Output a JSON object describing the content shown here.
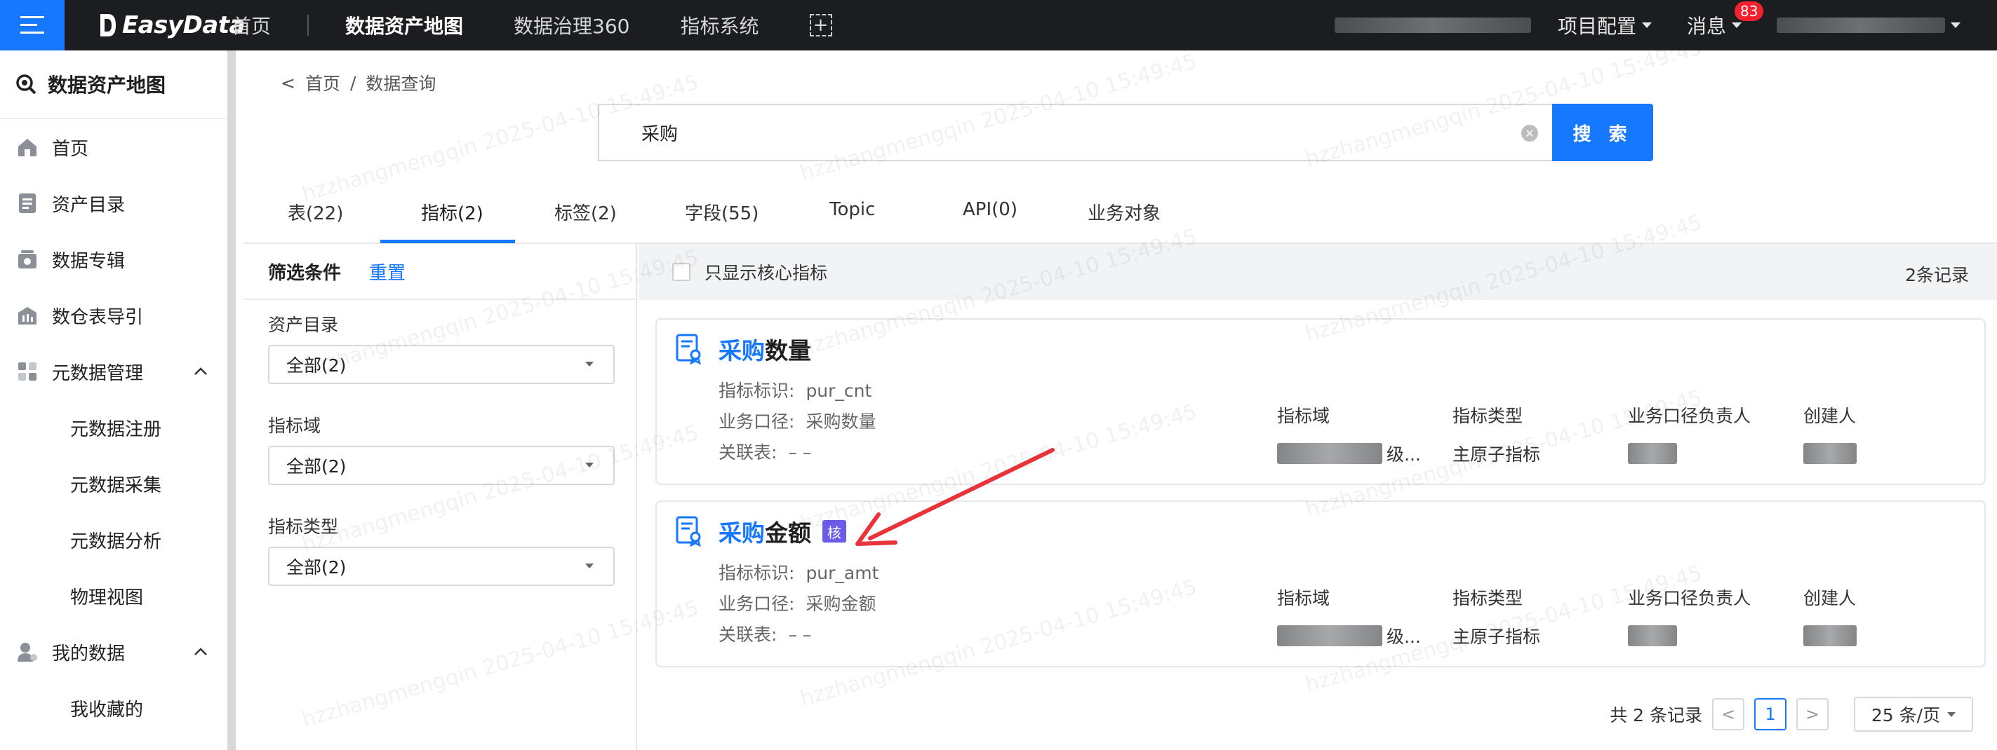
{
  "topbar": {
    "logo_text": "EasyData",
    "nav": [
      "首页",
      "数据资产地图",
      "数据治理360",
      "指标系统"
    ],
    "active_nav": "数据资产地图",
    "add_tab": "+",
    "project_config": "项目配置",
    "messages": "消息",
    "messages_count": "83"
  },
  "sidebar": {
    "title": "数据资产地图",
    "items": [
      "首页",
      "资产目录",
      "数据专辑",
      "数仓表导引"
    ],
    "group_meta": "元数据管理",
    "meta_children": [
      "元数据注册",
      "元数据采集",
      "元数据分析",
      "物理视图"
    ],
    "group_mine": "我的数据",
    "mine_children": [
      "我收藏的"
    ]
  },
  "breadcrumb": {
    "back": "<",
    "home": "首页",
    "sep": "/",
    "current": "数据查询"
  },
  "search": {
    "value": "采购",
    "button": "搜 索"
  },
  "tabs": [
    "表(22)",
    "指标(2)",
    "标签(2)",
    "字段(55)",
    "Topic",
    "API(0)",
    "业务对象"
  ],
  "active_tab": "指标(2)",
  "filter": {
    "title": "筛选条件",
    "reset": "重置",
    "catalog_label": "资产目录",
    "catalog_value": "全部(2)",
    "domain_label": "指标域",
    "domain_value": "全部(2)",
    "type_label": "指标类型",
    "type_value": "全部(2)"
  },
  "results_head": {
    "core_only": "只显示核心指标",
    "record_count": "2条记录"
  },
  "cards": [
    {
      "title_highlight": "采购",
      "title_rest": "数量",
      "core": "",
      "id_label": "指标标识:",
      "id_value": "pur_cnt",
      "biz_label": "业务口径:",
      "biz_value": "采购数量",
      "rel_label": "关联表:",
      "rel_value": "– –",
      "col_domain": "指标域",
      "domain_value": "级...",
      "col_type": "指标类型",
      "type_value": "主原子指标",
      "col_owner": "业务口径负责人",
      "col_creator": "创建人"
    },
    {
      "title_highlight": "采购",
      "title_rest": "金额",
      "core": "核",
      "id_label": "指标标识:",
      "id_value": "pur_amt",
      "biz_label": "业务口径:",
      "biz_value": "采购金额",
      "rel_label": "关联表:",
      "rel_value": "– –",
      "col_domain": "指标域",
      "domain_value": "级...",
      "col_type": "指标类型",
      "type_value": "主原子指标",
      "col_owner": "业务口径负责人",
      "col_creator": "创建人"
    }
  ],
  "pager": {
    "total": "共 2 条记录",
    "prev": "<",
    "current": "1",
    "next": ">",
    "size": "25 条/页"
  },
  "watermark": "hzzhangmengqin 2025-04-10 15:49:45",
  "colors": {
    "primary": "#1677ff",
    "topbar": "#1c1d21",
    "core_badge": "#6d5ce8",
    "annotation_arrow": "#e8333a"
  }
}
